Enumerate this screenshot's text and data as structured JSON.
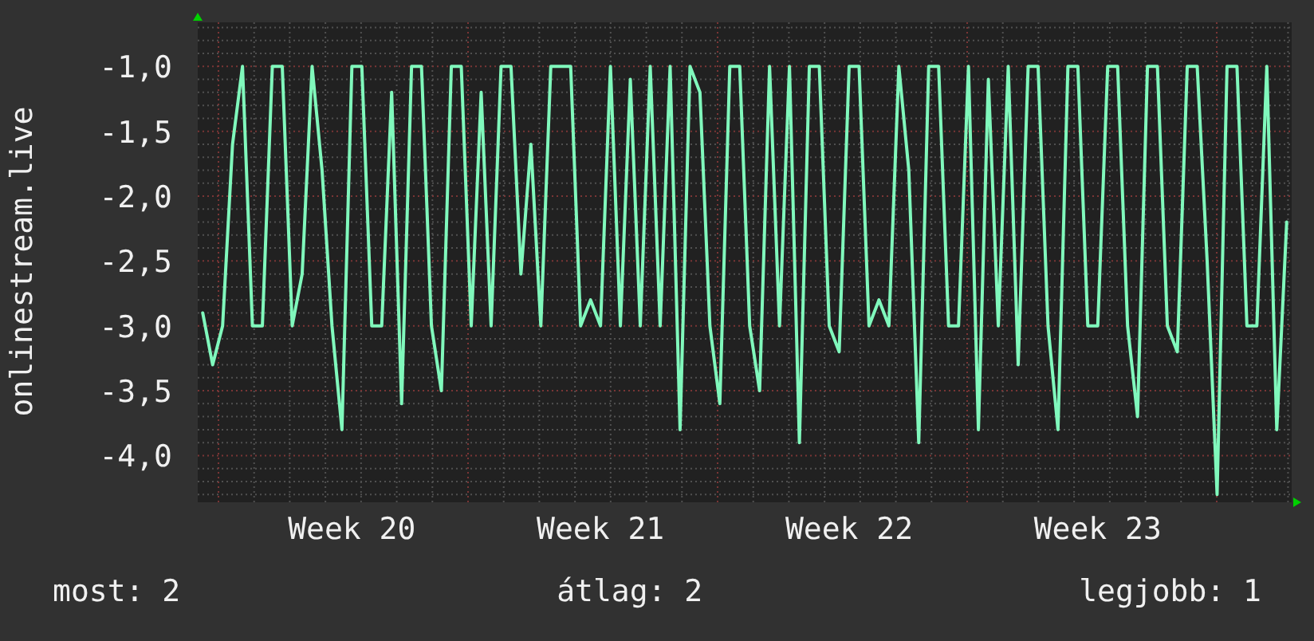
{
  "chart": {
    "chart_data": {
      "type": "line",
      "ylabel": "onlinestream.live",
      "categories": [
        null,
        null,
        null,
        null,
        null,
        null,
        null,
        null,
        null,
        null,
        null,
        null,
        null,
        null,
        null,
        "Week 20",
        null,
        null,
        null,
        null,
        null,
        null,
        null,
        null,
        null,
        null,
        null,
        null,
        null,
        null,
        null,
        null,
        null,
        null,
        null,
        null,
        null,
        null,
        null,
        null,
        "Week 21",
        null,
        null,
        null,
        null,
        null,
        null,
        null,
        null,
        null,
        null,
        null,
        null,
        null,
        null,
        null,
        null,
        null,
        null,
        null,
        null,
        null,
        null,
        null,
        null,
        "Week 22",
        null,
        null,
        null,
        null,
        null,
        null,
        null,
        null,
        null,
        null,
        null,
        null,
        null,
        null,
        null,
        null,
        null,
        null,
        null,
        null,
        null,
        null,
        null,
        null,
        "Week 23",
        null,
        null,
        null,
        null,
        null,
        null,
        null,
        null,
        null,
        null,
        null,
        null,
        null,
        null,
        null,
        null,
        null,
        null,
        null
      ],
      "series": [
        {
          "color": "#80f8bc",
          "values": [
            -2.9,
            -3.3,
            -3.0,
            -1.6,
            -1.0,
            -3.0,
            -3.0,
            -1.0,
            -1.0,
            -3.0,
            -2.6,
            -1.0,
            -1.8,
            -3.0,
            -3.8,
            -1.0,
            -1.0,
            -3.0,
            -3.0,
            -1.2,
            -3.6,
            -1.0,
            -1.0,
            -3.0,
            -3.5,
            -1.0,
            -1.0,
            -3.0,
            -1.2,
            -3.0,
            -1.0,
            -1.0,
            -2.6,
            -1.6,
            -3.0,
            -1.0,
            -1.0,
            -1.0,
            -3.0,
            -2.8,
            -3.0,
            -1.0,
            -3.0,
            -1.1,
            -3.0,
            -1.0,
            -3.0,
            -1.0,
            -3.8,
            -1.0,
            -1.2,
            -3.0,
            -3.6,
            -1.0,
            -1.0,
            -3.0,
            -3.5,
            -1.0,
            -3.0,
            -1.0,
            -3.9,
            -1.0,
            -1.0,
            -3.0,
            -3.2,
            -1.0,
            -1.0,
            -3.0,
            -2.8,
            -3.0,
            -1.0,
            -1.8,
            -3.9,
            -1.0,
            -1.0,
            -3.0,
            -3.0,
            -1.0,
            -3.8,
            -1.1,
            -3.0,
            -1.0,
            -3.3,
            -1.0,
            -1.0,
            -3.0,
            -3.8,
            -1.0,
            -1.0,
            -3.0,
            -3.0,
            -1.0,
            -1.0,
            -3.0,
            -3.7,
            -1.0,
            -1.0,
            -3.0,
            -3.2,
            -1.0,
            -1.0,
            -2.5,
            -4.3,
            -1.0,
            -1.0,
            -3.0,
            -3.0,
            -1.0,
            -3.8,
            -2.2
          ]
        }
      ],
      "grid": true,
      "ylim": [
        -4.36,
        -0.66
      ],
      "yticks": [
        {
          "value": -1,
          "label": "-1,0"
        },
        {
          "value": -1.5,
          "label": "-1,5"
        },
        {
          "value": -2,
          "label": "-2,0"
        },
        {
          "value": -2.5,
          "label": "-2,5"
        },
        {
          "value": -3,
          "label": "-3,0"
        },
        {
          "value": -3.5,
          "label": "-3,5"
        },
        {
          "value": -4,
          "label": "-4,0"
        }
      ]
    }
  },
  "stats": [
    "most: 2",
    "átlag: 2",
    "legjobb: 1"
  ]
}
